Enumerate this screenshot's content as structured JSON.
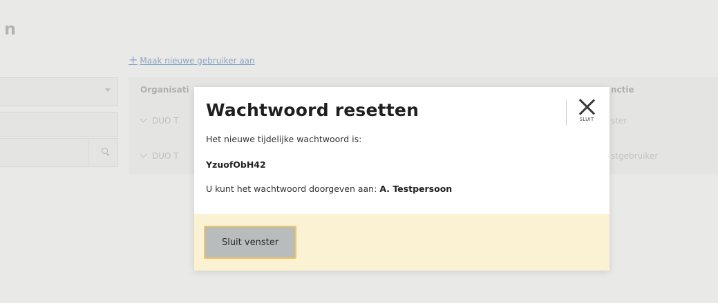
{
  "page": {
    "title_fragment": "n",
    "create_link": "Maak nieuwe gebruiker aan",
    "table": {
      "col_org": "Organisati",
      "col_function": "nctie",
      "rows": [
        {
          "org": "DUO T",
          "function": "ster"
        },
        {
          "org": "DUO T",
          "function": "stgebruiker"
        }
      ]
    }
  },
  "modal": {
    "title": "Wachtwoord resetten",
    "close_label": "SLUIT",
    "intro": "Het nieuwe tijdelijke wachtwoord is:",
    "password": "YzuofObH42",
    "forward_text": "U kunt het wachtwoord doorgeven aan:",
    "recipient": "A. Testpersoon",
    "button_label": "Sluit venster"
  },
  "colors": {
    "footer_bg": "#fbf2d3",
    "button_bg": "#b9bcbd",
    "button_border": "#f2c45f",
    "link": "#8aa6c4"
  },
  "icons": [
    "close-icon",
    "chevron-down-icon",
    "search-icon",
    "plus-icon",
    "caret-down-icon"
  ]
}
